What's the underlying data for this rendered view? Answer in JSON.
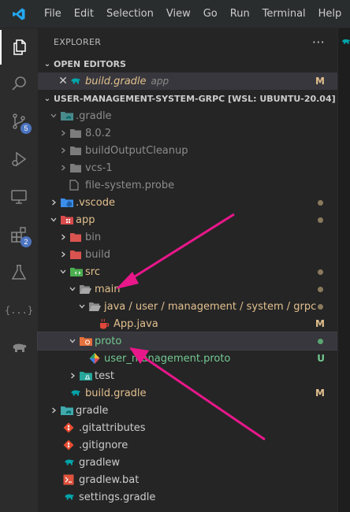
{
  "menu": [
    "File",
    "Edit",
    "Selection",
    "View",
    "Go",
    "Run",
    "Terminal",
    "Help"
  ],
  "activity": {
    "scm_badge": "5",
    "extensions_badge": "2",
    "json_icon_text": "{...}"
  },
  "explorer": {
    "title": "EXPLORER",
    "more": "···"
  },
  "open_editors": {
    "title": "OPEN EDITORS",
    "items": [
      {
        "name": "build.gradle",
        "folder": "app",
        "status": "M"
      }
    ]
  },
  "workspace": {
    "title": "USER-MANAGEMENT-SYSTEM-GRPC [WSL: UBUNTU-20.04]"
  },
  "tree": [
    {
      "label": ".gradle",
      "status": ""
    },
    {
      "label": "8.0.2",
      "status": ""
    },
    {
      "label": "buildOutputCleanup",
      "status": ""
    },
    {
      "label": "vcs-1",
      "status": ""
    },
    {
      "label": "file-system.probe",
      "status": ""
    },
    {
      "label": ".vscode",
      "status": ""
    },
    {
      "label": "app",
      "status": ""
    },
    {
      "label": "bin",
      "status": ""
    },
    {
      "label": "build",
      "status": ""
    },
    {
      "label": "src",
      "status": ""
    },
    {
      "label": "main",
      "status": ""
    },
    {
      "label": "java / user / management / system / grpc",
      "status": ""
    },
    {
      "label": "App.java",
      "status": "M"
    },
    {
      "label": "proto",
      "status": ""
    },
    {
      "label": "user_management.proto",
      "status": "U"
    },
    {
      "label": "test",
      "status": ""
    },
    {
      "label": "build.gradle",
      "status": "M"
    },
    {
      "label": "gradle",
      "status": ""
    },
    {
      "label": ".gitattributes",
      "status": ""
    },
    {
      "label": ".gitignore",
      "status": ""
    },
    {
      "label": "gradlew",
      "status": ""
    },
    {
      "label": "gradlew.bat",
      "status": ""
    },
    {
      "label": "settings.gradle",
      "status": ""
    }
  ],
  "colors": {
    "accent_arrow": "#e8178a",
    "modified": "#e2c08d",
    "untracked": "#73c991",
    "badge": "#4c74c0"
  }
}
